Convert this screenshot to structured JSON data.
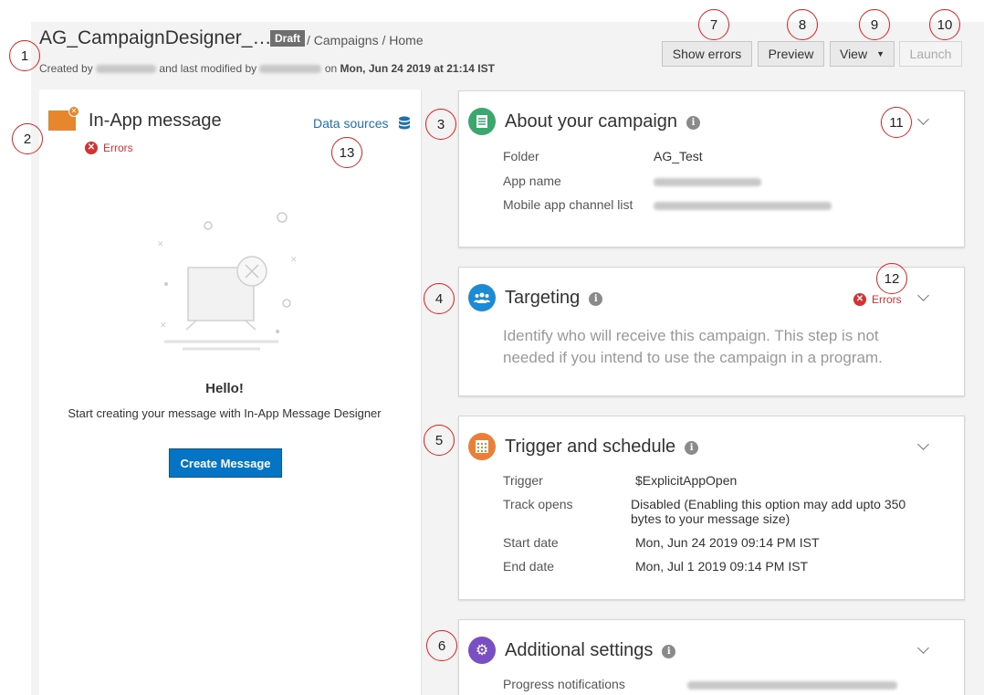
{
  "header": {
    "title": "AG_CampaignDesigner_…",
    "status_badge": "Draft",
    "breadcrumb": "/ Campaigns / Home",
    "meta_created_prefix": "Created by",
    "meta_modified_middle": "and last modified by",
    "meta_on": "on",
    "meta_date": "Mon, Jun 24 2019 at 21:14 IST"
  },
  "toolbar": {
    "show_errors": "Show errors",
    "preview": "Preview",
    "view": "View",
    "launch": "Launch"
  },
  "markers": [
    "1",
    "2",
    "3",
    "4",
    "5",
    "6",
    "7",
    "8",
    "9",
    "10",
    "11",
    "12",
    "13"
  ],
  "left_panel": {
    "title": "In-App message",
    "errors_label": "Errors",
    "data_sources": "Data sources",
    "hello": "Hello!",
    "hello_sub": "Start creating your message with In-App Message Designer",
    "create_button": "Create Message"
  },
  "cards": {
    "about": {
      "title": "About your campaign",
      "icon": "document-icon",
      "color": "#3aa76d",
      "folder_label": "Folder",
      "folder_value": "AG_Test",
      "app_name_label": "App name",
      "channel_list_label": "Mobile app channel list"
    },
    "targeting": {
      "title": "Targeting",
      "icon": "people-icon",
      "color": "#1d8ad6",
      "errors_label": "Errors",
      "description": "Identify who will receive this campaign. This step is not needed if you intend to use the campaign in a program."
    },
    "trigger": {
      "title": "Trigger and schedule",
      "icon": "calendar-icon",
      "color": "#ec7f35",
      "trigger_label": "Trigger",
      "trigger_value": "$ExplicitAppOpen",
      "track_label": "Track opens",
      "track_value": "Disabled (Enabling this option may add upto 350 bytes to your message size)",
      "start_label": "Start date",
      "start_value": "Mon, Jun 24 2019 09:14 PM IST",
      "end_label": "End date",
      "end_value": "Mon, Jul 1 2019 09:14 PM IST"
    },
    "additional": {
      "title": "Additional settings",
      "icon": "gear-icon",
      "color": "#7b4fc4",
      "progress_label": "Progress notifications"
    }
  }
}
